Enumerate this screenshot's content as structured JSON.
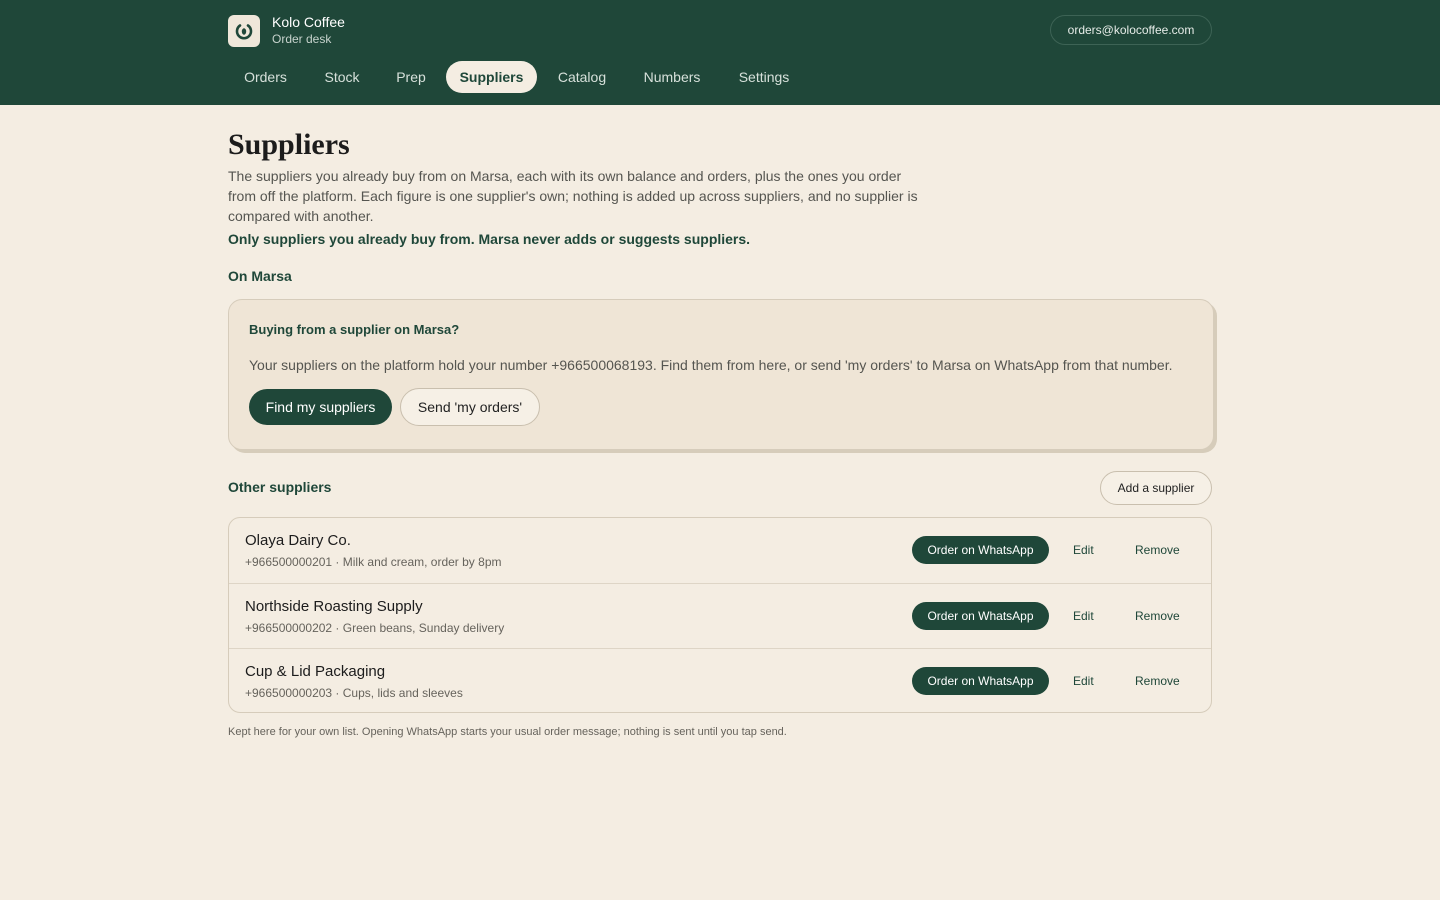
{
  "header": {
    "brand_name": "Kolo Coffee",
    "brand_sub": "Order desk",
    "email": "orders@kolocoffee.com",
    "logo_icon": "brand-mark-icon",
    "nav": [
      {
        "label": "Orders",
        "active": false
      },
      {
        "label": "Stock",
        "active": false
      },
      {
        "label": "Prep",
        "active": false
      },
      {
        "label": "Suppliers",
        "active": true
      },
      {
        "label": "Catalog",
        "active": false
      },
      {
        "label": "Numbers",
        "active": false
      },
      {
        "label": "Settings",
        "active": false
      }
    ]
  },
  "page": {
    "title": "Suppliers",
    "intro": "The suppliers you already buy from on Marsa, each with its own balance and orders, plus the ones you order from off the platform. Each figure is one supplier's own; nothing is added up across suppliers, and no supplier is compared with another.",
    "notice": "Only suppliers you already buy from. Marsa never adds or suggests suppliers."
  },
  "on_marsa": {
    "section_title": "On Marsa",
    "card_title": "Buying from a supplier on Marsa?",
    "card_body": "Your suppliers on the platform hold your number +966500068193. Find them from here, or send 'my orders' to Marsa on WhatsApp from that number.",
    "find_button": "Find my suppliers",
    "send_button": "Send 'my orders'"
  },
  "other": {
    "section_title": "Other suppliers",
    "add_button": "Add a supplier",
    "order_label": "Order on WhatsApp",
    "edit_label": "Edit",
    "remove_label": "Remove",
    "suppliers": [
      {
        "name": "Olaya Dairy Co.",
        "meta": "+966500000201 · Milk and cream, order by 8pm"
      },
      {
        "name": "Northside Roasting Supply",
        "meta": "+966500000202 · Green beans, Sunday delivery"
      },
      {
        "name": "Cup & Lid Packaging",
        "meta": "+966500000203 · Cups, lids and sleeves"
      }
    ],
    "footnote": "Kept here for your own list. Opening WhatsApp starts your usual order message; nothing is sent until you tap send."
  },
  "colors": {
    "header_bg": "#1f4739",
    "page_bg": "#f4ede2",
    "accent": "#1f4739",
    "card_bg": "#efe5d6"
  }
}
